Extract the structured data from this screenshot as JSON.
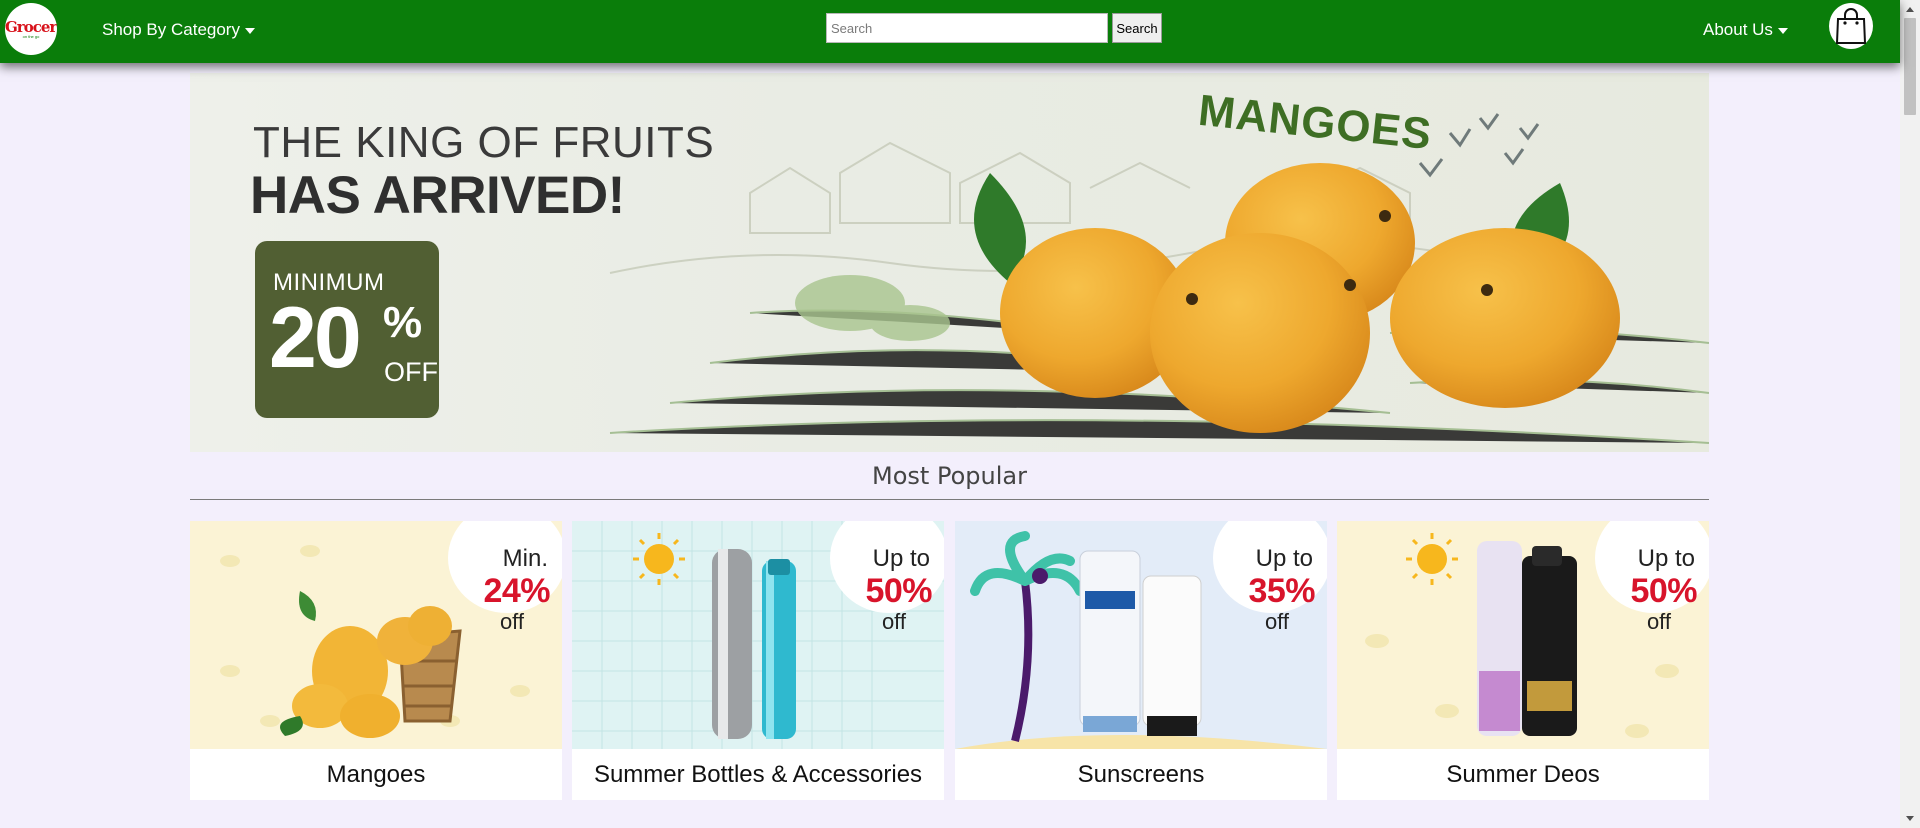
{
  "header": {
    "logo_text": "Grocery",
    "logo_subtext": "on the go",
    "shop_by_category": "Shop By Category",
    "search_placeholder": "Search",
    "search_button": "Search",
    "about_us": "About Us"
  },
  "hero": {
    "line1": "THE KING OF FRUITS",
    "line2": "HAS ARRIVED!",
    "promo_min": "MINIMUM",
    "promo_number": "20",
    "promo_percent": "%",
    "promo_off": "OFF",
    "product_word": "MANGOES"
  },
  "section": {
    "title": "Most Popular"
  },
  "cards": [
    {
      "label": "Mangoes",
      "badge_top": "Min.",
      "badge_pct": "24%",
      "badge_off": "off"
    },
    {
      "label": "Summer Bottles & Accessories",
      "badge_top": "Up to",
      "badge_pct": "50%",
      "badge_off": "off"
    },
    {
      "label": "Sunscreens",
      "badge_top": "Up to",
      "badge_pct": "35%",
      "badge_off": "off"
    },
    {
      "label": "Summer Deos",
      "badge_top": "Up to",
      "badge_pct": "50%",
      "badge_off": "off"
    }
  ],
  "colors": {
    "nav_green": "#0a7d0a",
    "page_background": "#f3effc",
    "discount_red": "#d8142b",
    "promo_olive": "#515f33"
  },
  "icons": {
    "category_caret": "caret-down-icon",
    "cart": "shopping-bag-icon"
  }
}
